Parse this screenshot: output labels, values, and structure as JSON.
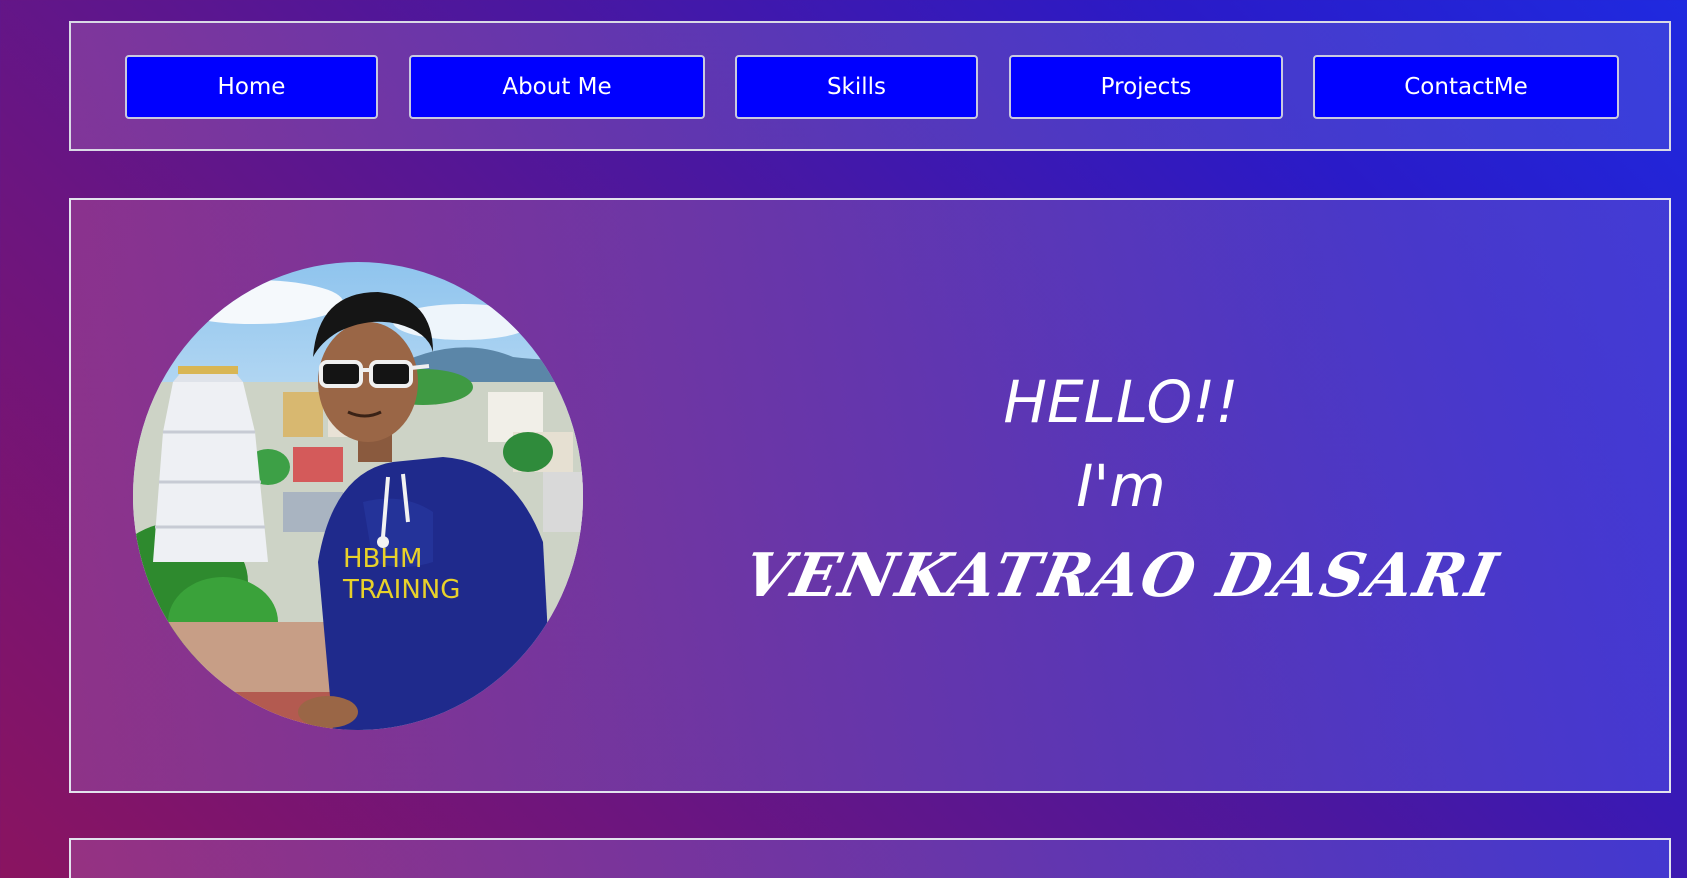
{
  "nav": {
    "items": [
      {
        "label": "Home"
      },
      {
        "label": "About Me"
      },
      {
        "label": "Skills"
      },
      {
        "label": "Projects"
      },
      {
        "label": "ContactMe"
      }
    ]
  },
  "hero": {
    "hello": "HELLO!!",
    "intro": "I'm",
    "name": "VENKATRAO DASARI",
    "photo_shirt_text_1": "HBHM",
    "photo_shirt_text_2": "TRAINNG"
  },
  "colors": {
    "nav_button_bg": "#0000ff",
    "text": "#ffffff"
  }
}
